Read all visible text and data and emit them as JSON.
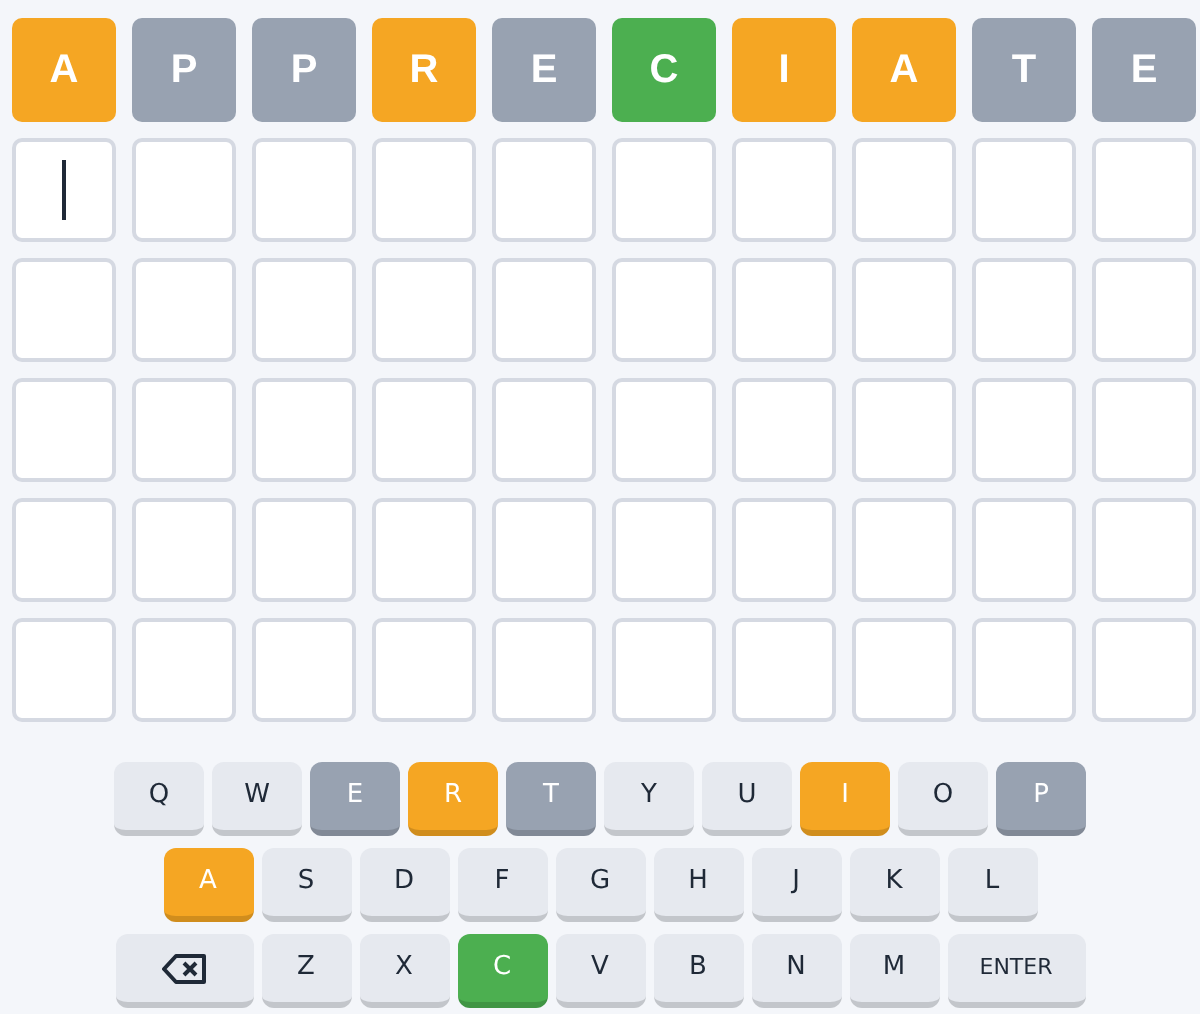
{
  "guess_row": [
    {
      "letter": "A",
      "color": "#f5a623"
    },
    {
      "letter": "P",
      "color": "#98a2b1"
    },
    {
      "letter": "P",
      "color": "#98a2b1"
    },
    {
      "letter": "R",
      "color": "#f5a623"
    },
    {
      "letter": "E",
      "color": "#98a2b1"
    },
    {
      "letter": "C",
      "color": "#4caf50"
    },
    {
      "letter": "I",
      "color": "#f5a623"
    },
    {
      "letter": "A",
      "color": "#f5a623"
    },
    {
      "letter": "T",
      "color": "#98a2b1"
    },
    {
      "letter": "E",
      "color": "#98a2b1"
    }
  ],
  "empty_rows": [
    [
      {
        "cursor": true
      },
      {
        "cursor": false
      },
      {
        "cursor": false
      },
      {
        "cursor": false
      },
      {
        "cursor": false
      },
      {
        "cursor": false
      },
      {
        "cursor": false
      },
      {
        "cursor": false
      },
      {
        "cursor": false
      },
      {
        "cursor": false
      }
    ],
    [
      {
        "cursor": false
      },
      {
        "cursor": false
      },
      {
        "cursor": false
      },
      {
        "cursor": false
      },
      {
        "cursor": false
      },
      {
        "cursor": false
      },
      {
        "cursor": false
      },
      {
        "cursor": false
      },
      {
        "cursor": false
      },
      {
        "cursor": false
      }
    ],
    [
      {
        "cursor": false
      },
      {
        "cursor": false
      },
      {
        "cursor": false
      },
      {
        "cursor": false
      },
      {
        "cursor": false
      },
      {
        "cursor": false
      },
      {
        "cursor": false
      },
      {
        "cursor": false
      },
      {
        "cursor": false
      },
      {
        "cursor": false
      }
    ],
    [
      {
        "cursor": false
      },
      {
        "cursor": false
      },
      {
        "cursor": false
      },
      {
        "cursor": false
      },
      {
        "cursor": false
      },
      {
        "cursor": false
      },
      {
        "cursor": false
      },
      {
        "cursor": false
      },
      {
        "cursor": false
      },
      {
        "cursor": false
      }
    ],
    [
      {
        "cursor": false
      },
      {
        "cursor": false
      },
      {
        "cursor": false
      },
      {
        "cursor": false
      },
      {
        "cursor": false
      },
      {
        "cursor": false
      },
      {
        "cursor": false
      },
      {
        "cursor": false
      },
      {
        "cursor": false
      },
      {
        "cursor": false
      }
    ]
  ],
  "keyboard": [
    [
      {
        "kind": "letter",
        "label": "Q",
        "color": "#e6e9ef"
      },
      {
        "kind": "letter",
        "label": "W",
        "color": "#e6e9ef"
      },
      {
        "kind": "letter",
        "label": "E",
        "color": "#98a2b1"
      },
      {
        "kind": "letter",
        "label": "R",
        "color": "#f5a623"
      },
      {
        "kind": "letter",
        "label": "T",
        "color": "#98a2b1"
      },
      {
        "kind": "letter",
        "label": "Y",
        "color": "#e6e9ef"
      },
      {
        "kind": "letter",
        "label": "U",
        "color": "#e6e9ef"
      },
      {
        "kind": "letter",
        "label": "I",
        "color": "#f5a623"
      },
      {
        "kind": "letter",
        "label": "O",
        "color": "#e6e9ef"
      },
      {
        "kind": "letter",
        "label": "P",
        "color": "#98a2b1"
      }
    ],
    [
      {
        "kind": "letter",
        "label": "A",
        "color": "#f5a623"
      },
      {
        "kind": "letter",
        "label": "S",
        "color": "#e6e9ef"
      },
      {
        "kind": "letter",
        "label": "D",
        "color": "#e6e9ef"
      },
      {
        "kind": "letter",
        "label": "F",
        "color": "#e6e9ef"
      },
      {
        "kind": "letter",
        "label": "G",
        "color": "#e6e9ef"
      },
      {
        "kind": "letter",
        "label": "H",
        "color": "#e6e9ef"
      },
      {
        "kind": "letter",
        "label": "J",
        "color": "#e6e9ef"
      },
      {
        "kind": "letter",
        "label": "K",
        "color": "#e6e9ef"
      },
      {
        "kind": "letter",
        "label": "L",
        "color": "#e6e9ef"
      }
    ],
    [
      {
        "kind": "backspace",
        "color": "#e6e9ef"
      },
      {
        "kind": "letter",
        "label": "Z",
        "color": "#e6e9ef"
      },
      {
        "kind": "letter",
        "label": "X",
        "color": "#e6e9ef"
      },
      {
        "kind": "letter",
        "label": "C",
        "color": "#4caf50"
      },
      {
        "kind": "letter",
        "label": "V",
        "color": "#e6e9ef"
      },
      {
        "kind": "letter",
        "label": "B",
        "color": "#e6e9ef"
      },
      {
        "kind": "letter",
        "label": "N",
        "color": "#e6e9ef"
      },
      {
        "kind": "letter",
        "label": "M",
        "color": "#e6e9ef"
      },
      {
        "kind": "enter",
        "label": "ENTER",
        "color": "#e6e9ef"
      }
    ]
  ]
}
